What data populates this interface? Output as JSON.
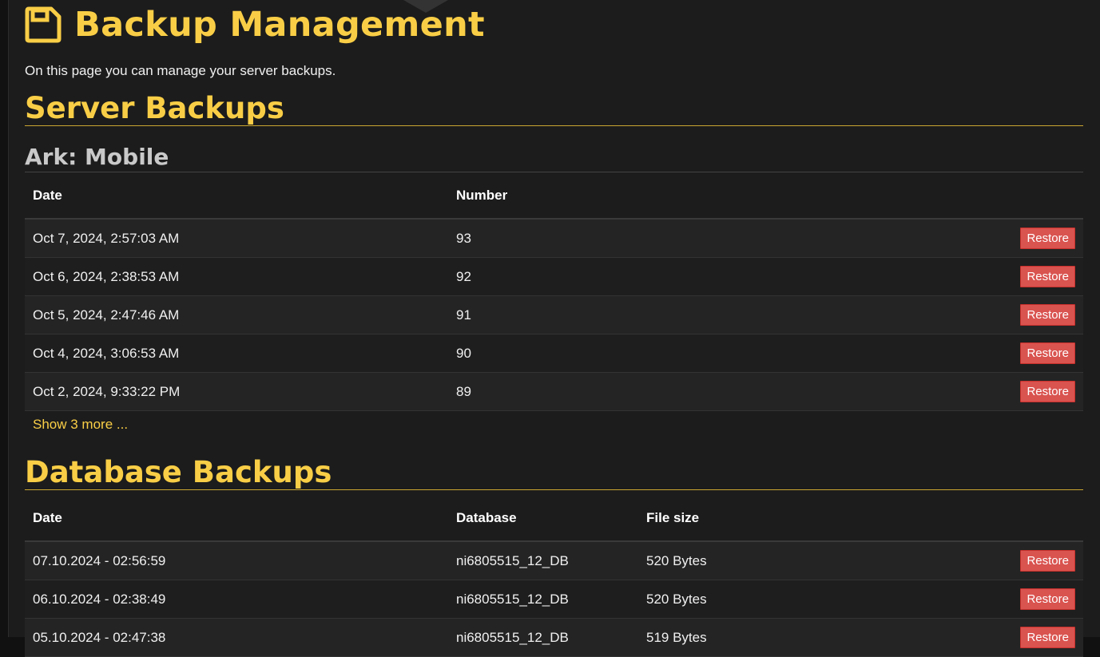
{
  "page": {
    "title": "Backup Management",
    "intro": "On this page you can manage your server backups."
  },
  "server_backups": {
    "heading": "Server Backups",
    "server_name": "Ark: Mobile",
    "columns": {
      "date": "Date",
      "number": "Number"
    },
    "rows": [
      {
        "date": "Oct 7, 2024, 2:57:03 AM",
        "number": "93",
        "action": "Restore"
      },
      {
        "date": "Oct 6, 2024, 2:38:53 AM",
        "number": "92",
        "action": "Restore"
      },
      {
        "date": "Oct 5, 2024, 2:47:46 AM",
        "number": "91",
        "action": "Restore"
      },
      {
        "date": "Oct 4, 2024, 3:06:53 AM",
        "number": "90",
        "action": "Restore"
      },
      {
        "date": "Oct 2, 2024, 9:33:22 PM",
        "number": "89",
        "action": "Restore"
      }
    ],
    "show_more": "Show 3 more ..."
  },
  "database_backups": {
    "heading": "Database Backups",
    "columns": {
      "date": "Date",
      "database": "Database",
      "file_size": "File size"
    },
    "rows": [
      {
        "date": "07.10.2024 - 02:56:59",
        "database": "ni6805515_12_DB",
        "file_size": "520 Bytes",
        "action": "Restore"
      },
      {
        "date": "06.10.2024 - 02:38:49",
        "database": "ni6805515_12_DB",
        "file_size": "520 Bytes",
        "action": "Restore"
      },
      {
        "date": "05.10.2024 - 02:47:38",
        "database": "ni6805515_12_DB",
        "file_size": "519 Bytes",
        "action": "Restore"
      }
    ]
  },
  "colors": {
    "accent": "#f9ce46",
    "background": "#1c1c1c",
    "danger": "#d9534f"
  },
  "icons": {
    "title": "floppy-disk-icon"
  }
}
